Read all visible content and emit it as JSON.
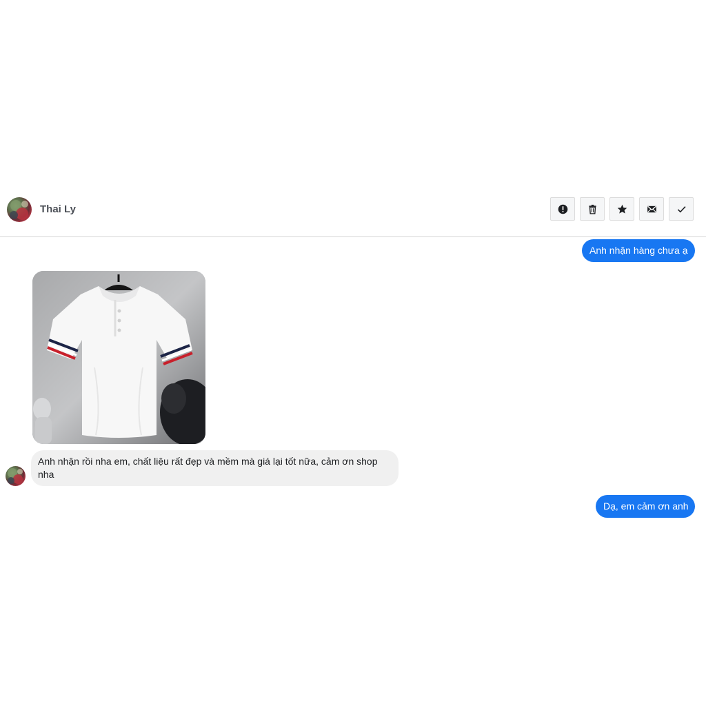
{
  "header": {
    "contact_name": "Thai Ly",
    "actions": [
      {
        "icon": "alert-icon"
      },
      {
        "icon": "trash-icon"
      },
      {
        "icon": "star-icon"
      },
      {
        "icon": "envelope-icon"
      },
      {
        "icon": "check-icon"
      }
    ]
  },
  "messages": {
    "outgoing_1": "Anh nhận hàng chưa ạ",
    "incoming_1": "Anh nhận rồi nha em, chất liệu rất đẹp và mềm mà giá lại tốt nữa, cảm ơn shop nha",
    "outgoing_2": "Dạ, em cảm ơn anh"
  },
  "colors": {
    "outgoing_bubble": "#1877f2",
    "incoming_bubble": "#f0f0f0"
  }
}
